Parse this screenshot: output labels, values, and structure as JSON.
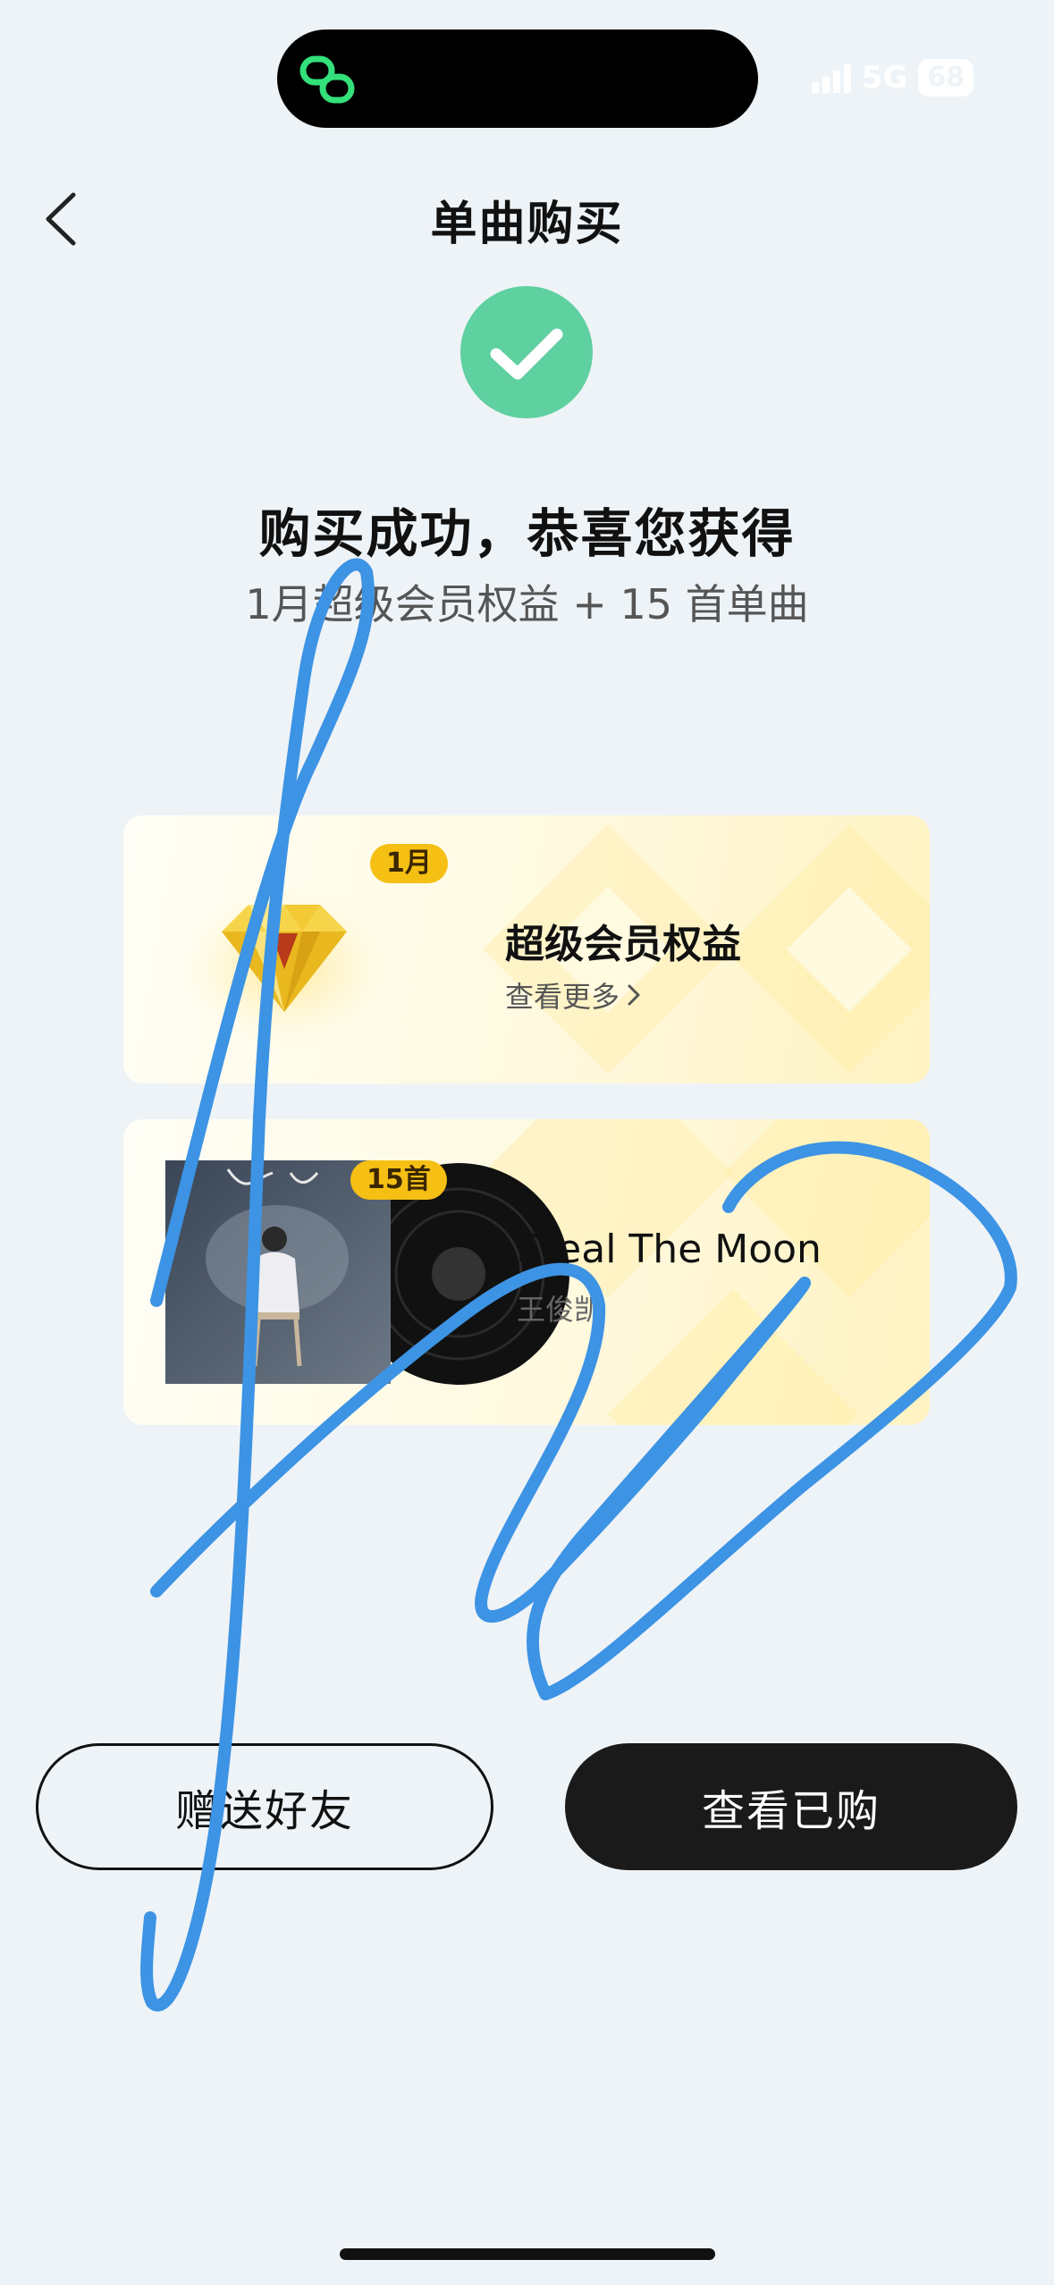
{
  "status_bar": {
    "network": "5G",
    "battery": "68"
  },
  "nav": {
    "title": "单曲购买"
  },
  "success": {
    "headline": "购买成功，恭喜您获得",
    "subline": "1月超级会员权益 + 15 首单曲"
  },
  "vip_card": {
    "badge": "1月",
    "title": "超级会员权益",
    "more_label": "查看更多"
  },
  "song_card": {
    "badge": "15首",
    "title": "Steal The Moon",
    "artist": "王俊凯"
  },
  "buttons": {
    "gift": "赠送好友",
    "view": "查看已购"
  },
  "colors": {
    "accent_green": "#5fd0a0",
    "badge_gold": "#f5bf14",
    "scribble_blue": "#3d93e4",
    "dark_button": "#1a1a1a"
  },
  "icons": {
    "app": "link-rings-icon",
    "back": "chevron-left-icon",
    "success": "check-circle-icon",
    "more": "chevron-right-icon",
    "vip": "diamond-icon"
  }
}
